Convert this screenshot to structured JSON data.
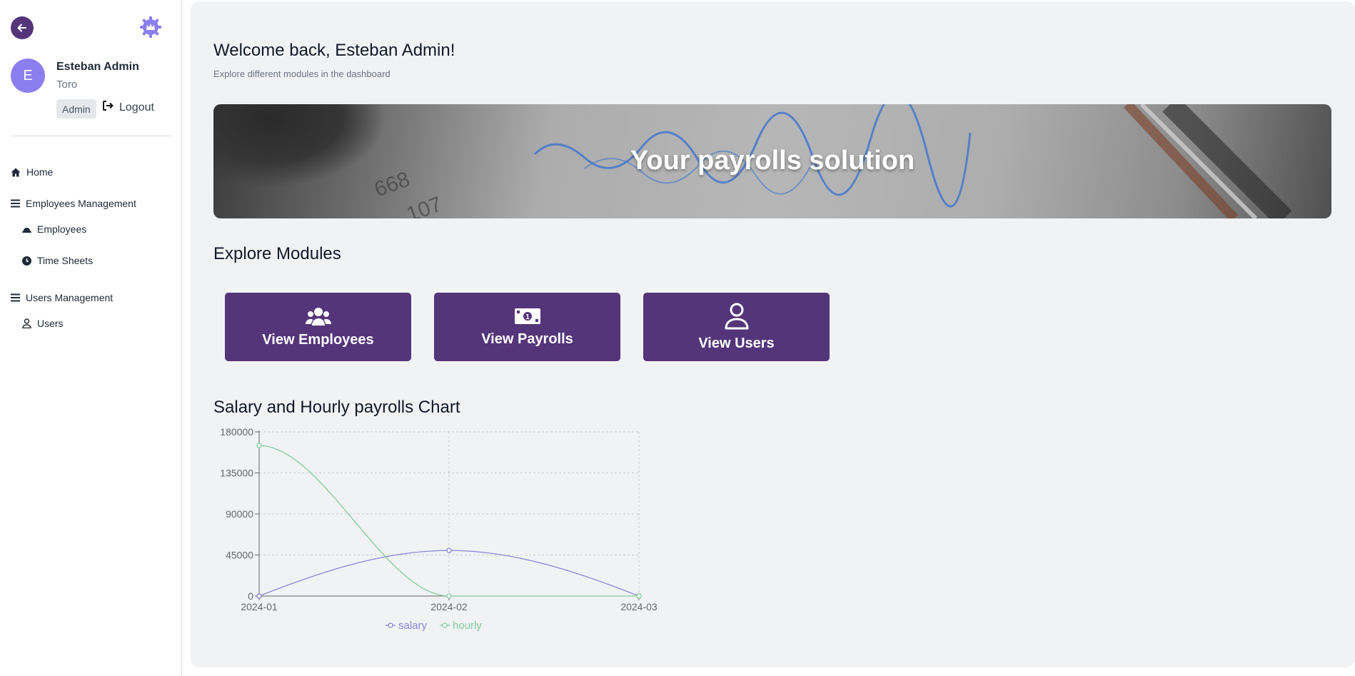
{
  "sidebar": {
    "user": {
      "initial": "E",
      "name": "Esteban Admin",
      "subtitle": "Toro",
      "role": "Admin",
      "logout_label": "Logout"
    },
    "nav": {
      "home": "Home",
      "employees_management": "Employees Management",
      "employees": "Employees",
      "time_sheets": "Time Sheets",
      "users_management": "Users Management",
      "users": "Users"
    }
  },
  "main": {
    "welcome": "Welcome back, Esteban Admin!",
    "welcome_sub": "Explore different modules in the dashboard",
    "banner_title": "Your payrolls solution",
    "modules_title": "Explore Modules",
    "modules": [
      "View Employees",
      "View Payrolls",
      "View Users"
    ],
    "chart_title": "Salary and Hourly payrolls Chart"
  },
  "colors": {
    "accent": "#55357a",
    "avatar": "#8b7ff0",
    "salary": "#8884d8",
    "hourly": "#82ca9d"
  },
  "chart_data": {
    "type": "line",
    "categories": [
      "2024-01",
      "2024-02",
      "2024-03"
    ],
    "series": [
      {
        "name": "salary",
        "values": [
          0,
          50000,
          0
        ]
      },
      {
        "name": "hourly",
        "values": [
          165000,
          0,
          0
        ]
      }
    ],
    "yticks": [
      0,
      45000,
      90000,
      135000,
      180000
    ],
    "ylim": [
      0,
      180000
    ],
    "grid": true,
    "legend": "bottom"
  }
}
